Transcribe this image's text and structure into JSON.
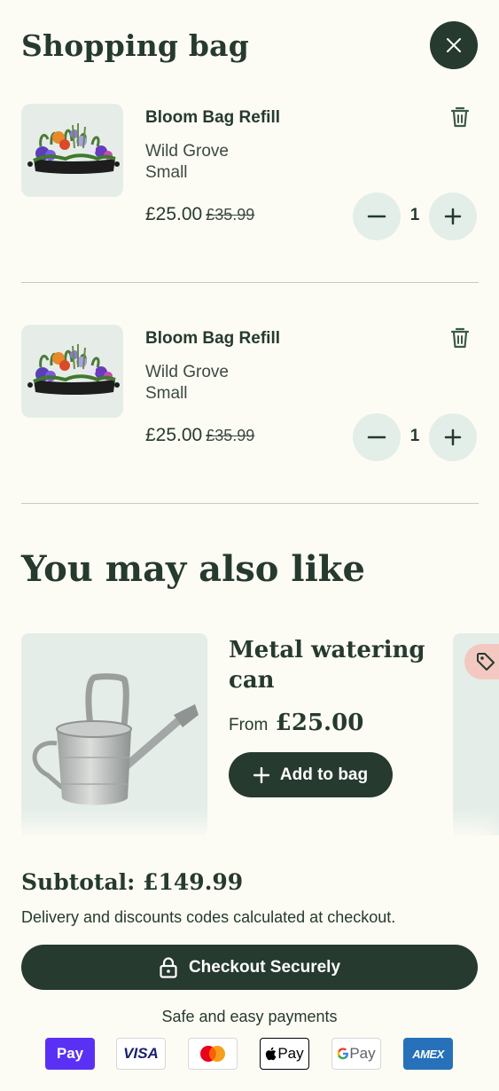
{
  "header": {
    "title": "Shopping bag",
    "close_icon": "close-icon"
  },
  "cart": {
    "items": [
      {
        "name": "Bloom Bag Refill",
        "variant_line1": "Wild Grove",
        "variant_line2": "Small",
        "price": "£25.00",
        "old_price": "£35.99",
        "quantity": "1"
      },
      {
        "name": "Bloom Bag Refill",
        "variant_line1": "Wild Grove",
        "variant_line2": "Small",
        "price": "£25.00",
        "old_price": "£35.99",
        "quantity": "1"
      }
    ]
  },
  "recommendations": {
    "title": "You may also like",
    "products": [
      {
        "name": "Metal watering can",
        "from_label": "From",
        "price": "£25.00",
        "add_label": "Add to bag"
      }
    ]
  },
  "footer": {
    "subtotal": "Subtotal: £149.99",
    "delivery_note": "Delivery and discounts codes calculated at checkout.",
    "checkout_label": "Checkout Securely",
    "safe_payments": "Safe and easy payments",
    "payment_methods": [
      {
        "name": "Shop Pay",
        "mark": "Pay"
      },
      {
        "name": "Visa",
        "mark": "VISA"
      },
      {
        "name": "Mastercard",
        "mark": ""
      },
      {
        "name": "Apple Pay",
        "mark": "Pay"
      },
      {
        "name": "Google Pay",
        "mark": "Pay"
      },
      {
        "name": "American Express",
        "mark": "AMEX"
      }
    ]
  },
  "colors": {
    "primary": "#263a2f",
    "background": "#fdfcf4",
    "qty_button": "#e3eee8",
    "sale_tag": "#f3c8c0"
  }
}
